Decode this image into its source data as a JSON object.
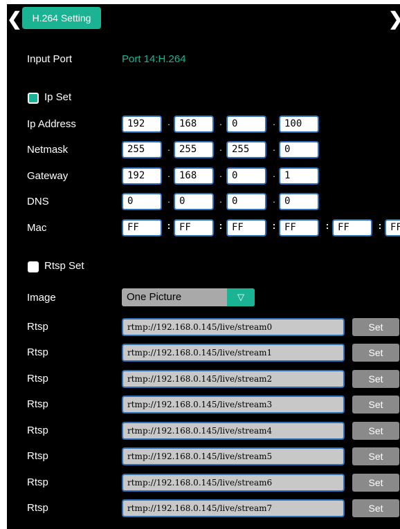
{
  "header": {
    "title": "H.264 Setting",
    "back_icon": "chevron-left-icon",
    "next_icon": "chevron-right-icon"
  },
  "input_port": {
    "label": "Input Port",
    "value": "Port 14:H.264"
  },
  "ip_set": {
    "label": "Ip Set",
    "checked": true
  },
  "network": {
    "ip_address": {
      "label": "Ip Address",
      "octets": [
        "192",
        "168",
        "0",
        "100"
      ]
    },
    "netmask": {
      "label": "Netmask",
      "octets": [
        "255",
        "255",
        "255",
        "0"
      ]
    },
    "gateway": {
      "label": "Gateway",
      "octets": [
        "192",
        "168",
        "0",
        "1"
      ]
    },
    "dns": {
      "label": "DNS",
      "octets": [
        "0",
        "0",
        "0",
        "0"
      ]
    },
    "mac": {
      "label": "Mac",
      "parts": [
        "FF",
        "FF",
        "FF",
        "FF",
        "FF",
        "FF"
      ]
    }
  },
  "rtsp_set": {
    "label": "Rtsp Set",
    "checked": false
  },
  "image": {
    "label": "Image",
    "selected": "One Picture",
    "dropdown_icon": "triangle-down-icon"
  },
  "rtsp": {
    "label": "Rtsp",
    "button_label": "Set",
    "urls": [
      "rtmp://192.168.0.145/live/stream0",
      "rtmp://192.168.0.145/live/stream1",
      "rtmp://192.168.0.145/live/stream2",
      "rtmp://192.168.0.145/live/stream3",
      "rtmp://192.168.0.145/live/stream4",
      "rtmp://192.168.0.145/live/stream5",
      "rtmp://192.168.0.145/live/stream6",
      "rtmp://192.168.0.145/live/stream7"
    ]
  },
  "colors": {
    "accent": "#1ab394",
    "field_border": "#2d6fb8",
    "background": "#000000",
    "set_button": "#8a8a8a"
  }
}
